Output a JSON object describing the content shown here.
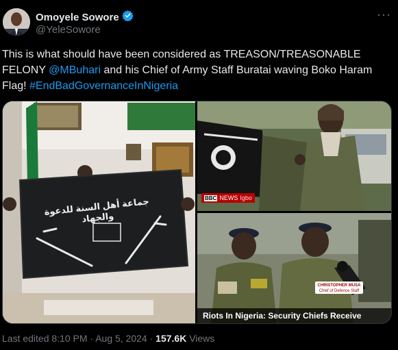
{
  "author": {
    "name": "Omoyele Sowore",
    "handle": "@YeleSowore",
    "verified_color": "#1d9bf0"
  },
  "more_label": "···",
  "tweet": {
    "text_before": "This is what should have been considered as TREASON/TREASONABLE FELONY ",
    "mention": "@MBuhari",
    "text_middle": " and his Chief of Army Staff Buratai waving Boko Haram Flag! ",
    "hashtag": "#EndBadGovernanceInNigeria"
  },
  "media": {
    "flag_text": "جماعة أهل السنة للدعوة والجهاد",
    "bbc_label": "NEWS",
    "bbc_sub": "Igbo",
    "bbc_brand": "BBC",
    "nameplate_name": "CHRISTOPHER MUSA",
    "nameplate_title": "Chief of Defence Staff",
    "caption": "Riots In Nigeria: Security Chiefs Receive"
  },
  "meta": {
    "edited": "Last edited 8:10 PM · Aug 5, 2024 · ",
    "views_count": "157.6K",
    "views_label": " Views"
  }
}
